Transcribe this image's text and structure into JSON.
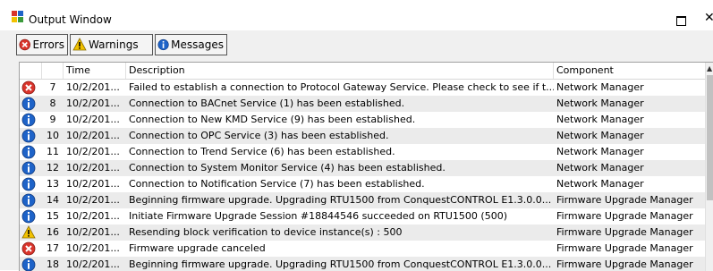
{
  "window": {
    "title": "Output Window",
    "maximize_glyph": "□",
    "close_glyph": "✕"
  },
  "toolbar": {
    "errors_label": "Errors",
    "warnings_label": "Warnings",
    "messages_label": "Messages"
  },
  "table": {
    "columns": [
      "",
      "",
      "Time",
      "Description",
      "Component"
    ],
    "rows": [
      {
        "icon": "error-icon",
        "id": "7",
        "time": "10/2/201...",
        "description": "Failed to establish a connection to Protocol Gateway Service.  Please check to see if t...",
        "component": "Network Manager"
      },
      {
        "icon": "info-icon",
        "id": "8",
        "time": "10/2/201...",
        "description": "Connection to BACnet Service (1) has been established.",
        "component": "Network Manager"
      },
      {
        "icon": "info-icon",
        "id": "9",
        "time": "10/2/201...",
        "description": "Connection to New KMD Service (9) has been established.",
        "component": "Network Manager"
      },
      {
        "icon": "info-icon",
        "id": "10",
        "time": "10/2/201...",
        "description": "Connection to OPC Service (3) has been established.",
        "component": "Network Manager"
      },
      {
        "icon": "info-icon",
        "id": "11",
        "time": "10/2/201...",
        "description": "Connection to Trend Service (6) has been established.",
        "component": "Network Manager"
      },
      {
        "icon": "info-icon",
        "id": "12",
        "time": "10/2/201...",
        "description": "Connection to System Monitor Service (4) has been established.",
        "component": "Network Manager"
      },
      {
        "icon": "info-icon",
        "id": "13",
        "time": "10/2/201...",
        "description": "Connection to Notification Service (7) has been established.",
        "component": "Network Manager"
      },
      {
        "icon": "info-icon",
        "id": "14",
        "time": "10/2/201...",
        "description": "Beginning firmware upgrade. Upgrading RTU1500  from ConquestCONTROL E1.3.0.0...",
        "component": "Firmware Upgrade Manager"
      },
      {
        "icon": "info-icon",
        "id": "15",
        "time": "10/2/201...",
        "description": "Initiate Firmware Upgrade Session #18844546 succeeded on RTU1500 (500)",
        "component": "Firmware Upgrade Manager"
      },
      {
        "icon": "warning-icon",
        "id": "16",
        "time": "10/2/201...",
        "description": "Resending block verification to device instance(s) : 500",
        "component": "Firmware Upgrade Manager"
      },
      {
        "icon": "error-icon",
        "id": "17",
        "time": "10/2/201...",
        "description": "Firmware upgrade canceled",
        "component": "Firmware Upgrade Manager"
      },
      {
        "icon": "info-icon",
        "id": "18",
        "time": "10/2/201...",
        "description": "Beginning firmware upgrade. Upgrading RTU1500  from ConquestCONTROL E1.3.0.0...",
        "component": "Firmware Upgrade Manager"
      }
    ]
  },
  "colors": {
    "error": "#d9342b",
    "info": "#1e63c8",
    "warning": "#f2c200"
  }
}
